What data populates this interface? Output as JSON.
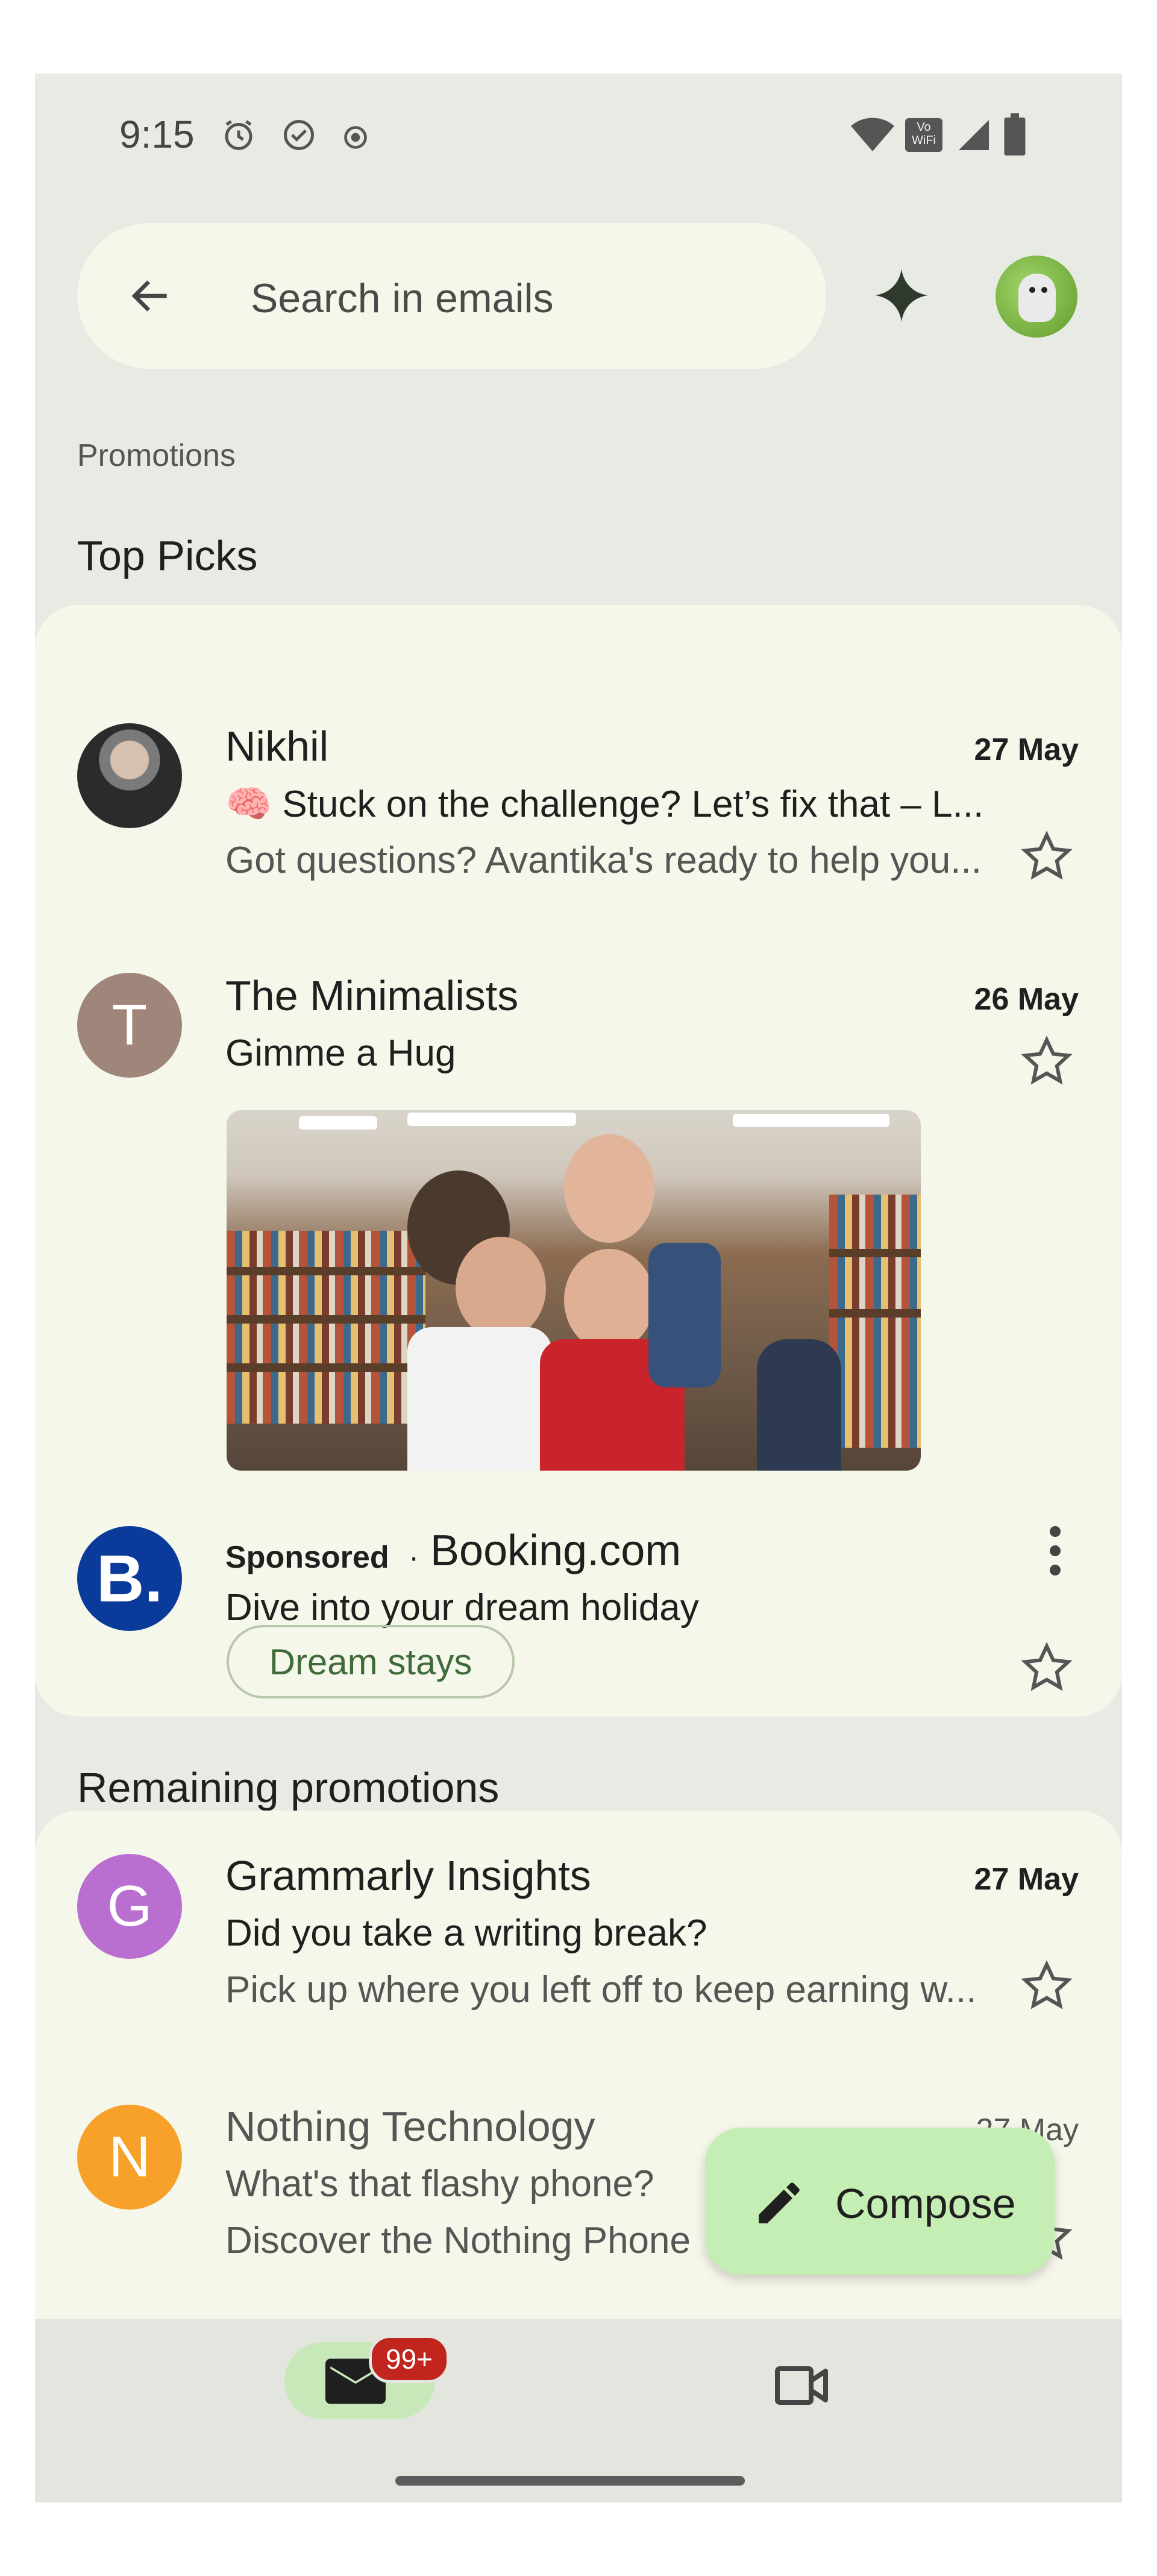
{
  "status_bar": {
    "time": "9:15",
    "vowifi_label": "Vo WiFi"
  },
  "search": {
    "placeholder": "Search in emails"
  },
  "header": {
    "section_label": "Promotions"
  },
  "top_picks": {
    "title": "Top Picks",
    "emails": [
      {
        "sender": "Nikhil",
        "date": "27 May",
        "subject": "🧠 Stuck on the challenge? Let’s fix that – L...",
        "snippet": "Got questions? Avantika's ready to help you...",
        "avatar_letter": ""
      },
      {
        "sender": "The Minimalists",
        "date": "26 May",
        "subject": "Gimme a Hug",
        "avatar_letter": "T",
        "avatar_color": "#a0857a"
      }
    ],
    "ad": {
      "sponsored_label": "Sponsored",
      "separator": "·",
      "advertiser": "Booking.com",
      "subject": "Dive into your dream holiday",
      "chip": "Dream stays",
      "avatar_letter": "B.",
      "avatar_color": "#0a3a9a"
    }
  },
  "remaining": {
    "title": "Remaining promotions",
    "emails": [
      {
        "sender": "Grammarly Insights",
        "date": "27 May",
        "subject": "Did you take a writing break?",
        "snippet": "Pick up where you left off to keep earning w...",
        "avatar_letter": "G",
        "avatar_color": "#b96fd0"
      },
      {
        "sender": "Nothing Technology",
        "date": "27 May",
        "subject": "What's that flashy phone?",
        "snippet": "Discover the Nothing Phone",
        "avatar_letter": "N",
        "avatar_color": "#f7a12a"
      }
    ]
  },
  "compose": {
    "label": "Compose"
  },
  "bottom_nav": {
    "mail_badge": "99+"
  },
  "colors": {
    "accent_green": "#c4eeb3",
    "badge_red": "#c1251d"
  }
}
